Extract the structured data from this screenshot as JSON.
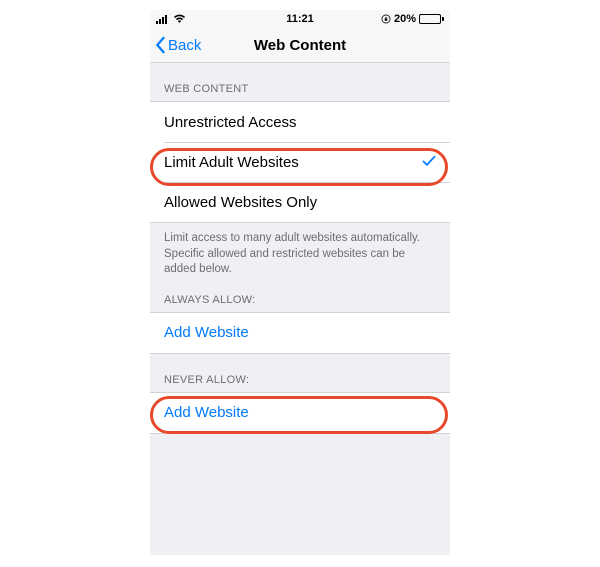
{
  "status_bar": {
    "time": "11:21",
    "battery_percent": "20%"
  },
  "nav": {
    "back_label": "Back",
    "title": "Web Content"
  },
  "section_web_content": {
    "header": "WEB CONTENT",
    "options": {
      "unrestricted": "Unrestricted Access",
      "limit_adult": "Limit Adult Websites",
      "allowed_only": "Allowed Websites Only"
    },
    "footer": "Limit access to many adult websites automatically. Specific allowed and restricted websites can be added below."
  },
  "section_always_allow": {
    "header": "ALWAYS ALLOW:",
    "add_label": "Add Website"
  },
  "section_never_allow": {
    "header": "NEVER ALLOW:",
    "add_label": "Add Website"
  }
}
